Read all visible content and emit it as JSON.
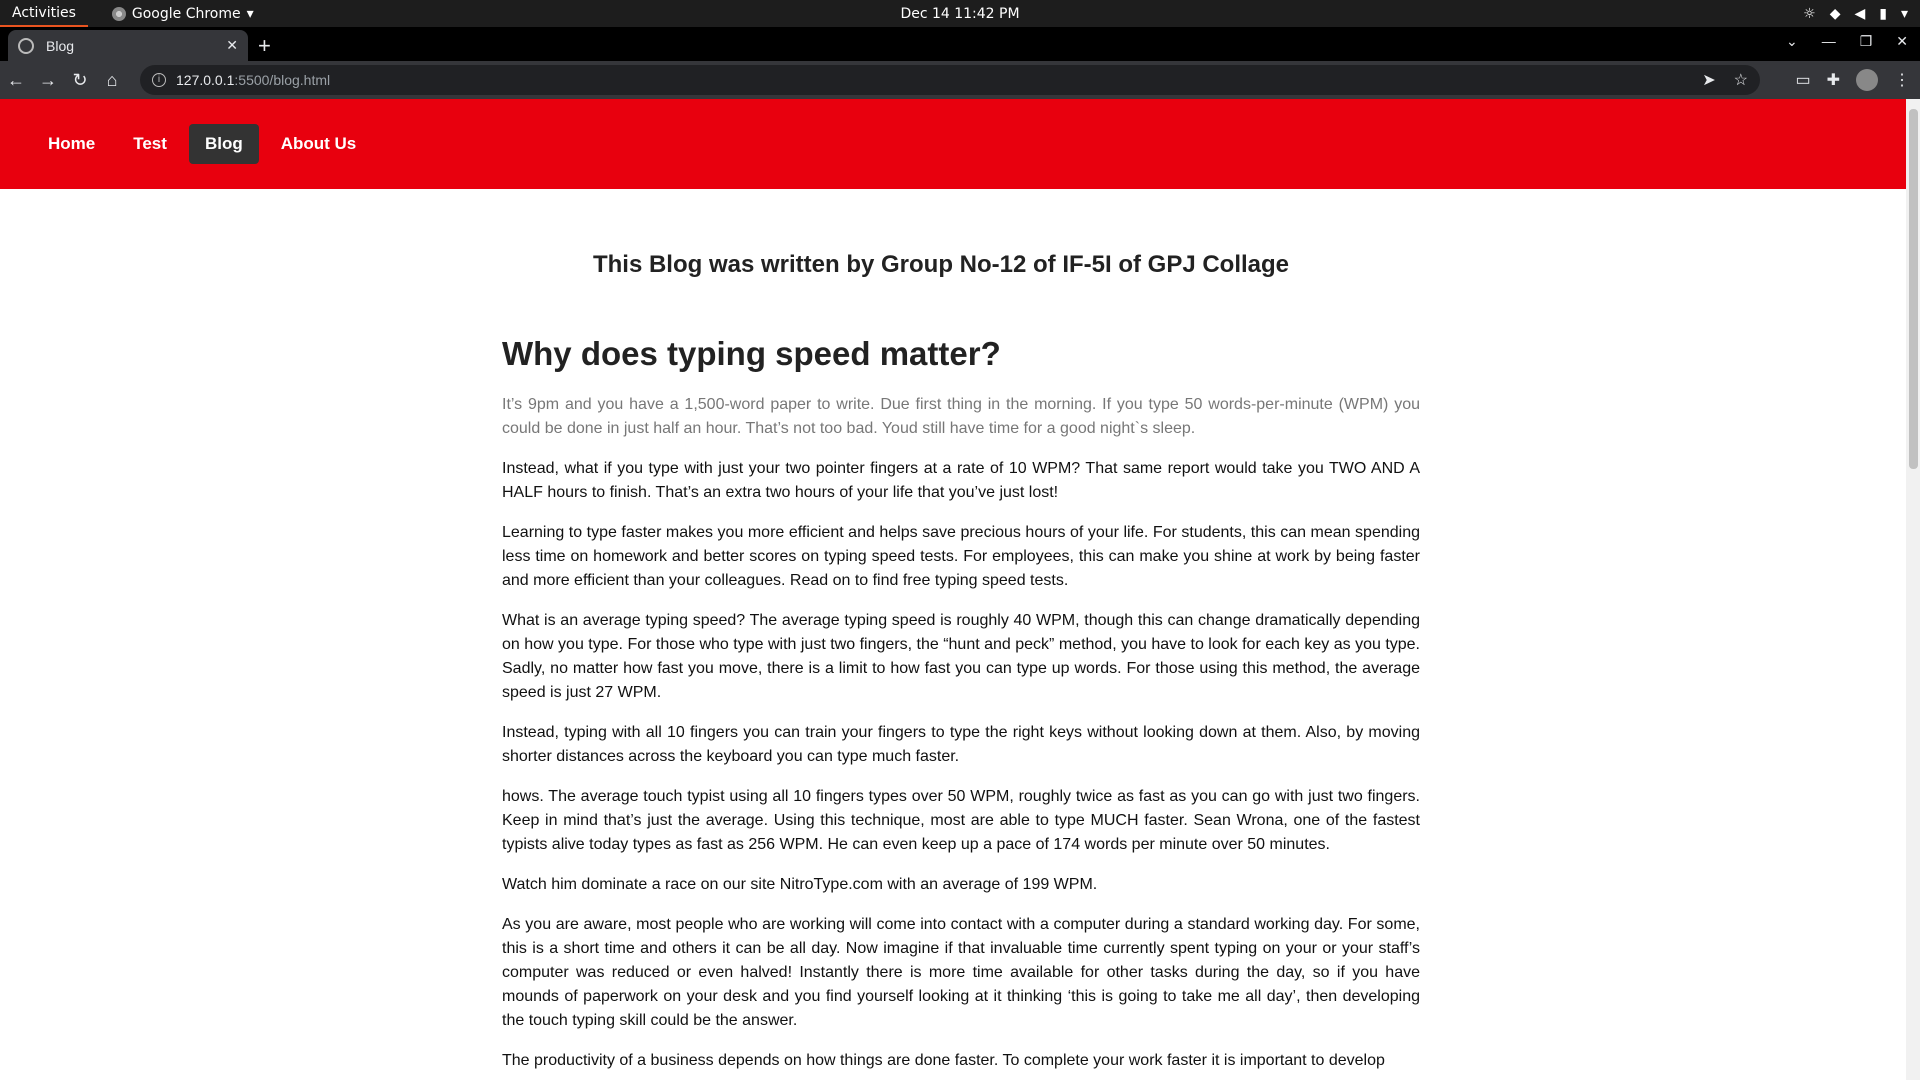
{
  "system": {
    "activities": "Activities",
    "app_name": "Google Chrome",
    "clock": "Dec 14  11:42 PM"
  },
  "browser": {
    "tab_title": "Blog",
    "url_host": "127.0.0.1",
    "url_path": ":5500/blog.html"
  },
  "nav": {
    "items": [
      {
        "label": "Home",
        "active": false
      },
      {
        "label": "Test",
        "active": false
      },
      {
        "label": "Blog",
        "active": true
      },
      {
        "label": "About Us",
        "active": false
      }
    ]
  },
  "page": {
    "byline": "This Blog was written by Group No-12 of IF-5I of GPJ Collage",
    "heading": "Why does typing speed matter?",
    "paragraphs": [
      "It’s 9pm and you have a 1,500-word paper to write. Due first thing in the morning. If you type 50 words-per-minute (WPM) you could be done in just half an hour. That’s not too bad. Youd still have time for a good night`s sleep.",
      "Instead, what if you type with just your two pointer fingers at a rate of 10 WPM? That same report would take you TWO AND A HALF hours to finish. That’s an extra two hours of your life that you’ve just lost!",
      "Learning to type faster makes you more efficient and helps save precious hours of your life. For students, this can mean spending less time on homework and better scores on typing speed tests. For employees, this can make you shine at work by being faster and more efficient than your colleagues. Read on to find free typing speed tests.",
      "What is an average typing speed? The average typing speed is roughly 40 WPM, though this can change dramatically depending on how you type. For those who type with just two fingers, the “hunt and peck” method, you have to look for each key as you type. Sadly, no matter how fast you move, there is a limit to how fast you can type up words. For those using this method, the average speed is just 27 WPM.",
      "Instead, typing with all 10 fingers you can train your fingers to type the right keys without looking down at them. Also, by moving shorter distances across the keyboard you can type much faster.",
      "hows. The average touch typist using all 10 fingers types over 50 WPM, roughly twice as fast as you can go with just two fingers. Keep in mind that’s just the average. Using this technique, most are able to type MUCH faster. Sean Wrona, one of the fastest typists alive today types as fast as 256 WPM. He can even keep up a pace of 174 words per minute over 50 minutes.",
      "Watch him dominate a race on our site NitroType.com with an average of 199 WPM.",
      "As you are aware, most people who are working will come into contact with a computer during a standard working day. For some, this is a short time and others it can be all day. Now imagine if that invaluable time currently spent typing on your or your staff’s computer was reduced or even halved! Instantly there is more time available for other tasks during the day, so if you have mounds of paperwork on your desk and you find yourself looking at it thinking ‘this is going to take me all day’, then developing the touch typing skill could be the answer.",
      "The productivity of a business depends on how things are done faster. To complete your work faster it is important to develop"
    ]
  }
}
